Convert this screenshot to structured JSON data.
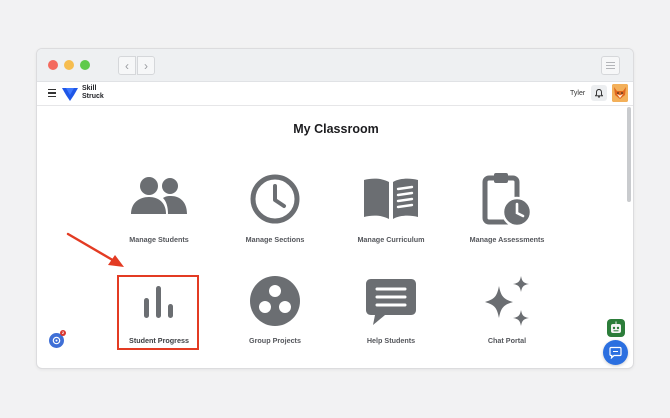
{
  "app": {
    "brand_line1": "Skill",
    "brand_line2": "Struck",
    "user_name": "Tyler",
    "brand_color": "#1f57e7"
  },
  "page": {
    "title": "My Classroom"
  },
  "tiles": [
    {
      "label": "Manage Students",
      "icon": "students-icon"
    },
    {
      "label": "Manage Sections",
      "icon": "clock-icon"
    },
    {
      "label": "Manage Curriculum",
      "icon": "book-icon"
    },
    {
      "label": "Manage Assessments",
      "icon": "clipboard-clock-icon"
    },
    {
      "label": "Student Progress",
      "icon": "bar-chart-icon"
    },
    {
      "label": "Group Projects",
      "icon": "group-circle-icon"
    },
    {
      "label": "Help Students",
      "icon": "chat-lines-icon"
    },
    {
      "label": "Chat Portal",
      "icon": "sparkles-icon"
    }
  ],
  "widgets": {
    "notification_count": "2"
  },
  "colors": {
    "icon_gray": "#6b6e72",
    "highlight": "#e33b23",
    "chat_button": "#2b6fe0"
  }
}
